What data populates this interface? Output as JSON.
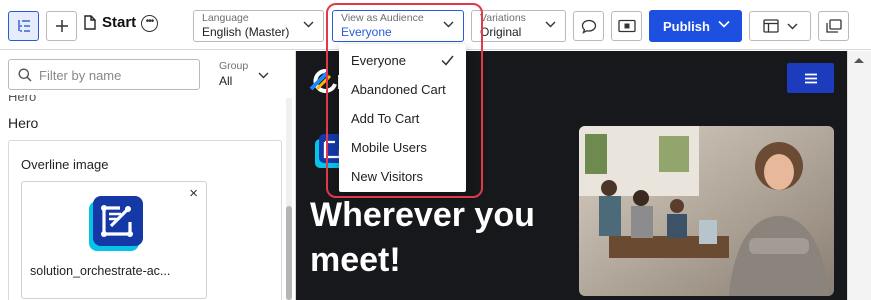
{
  "toolbar": {
    "page_title": "Start",
    "language": {
      "label": "Language",
      "value": "English (Master)"
    },
    "audience": {
      "label": "View as Audience",
      "value": "Everyone"
    },
    "variations": {
      "label": "Variations",
      "value": "Original"
    },
    "publish_label": "Publish"
  },
  "sidebar": {
    "filter_placeholder": "Filter by name",
    "group": {
      "label": "Group",
      "value": "All"
    },
    "crumb": "Hero",
    "section_title": "Hero",
    "card": {
      "title": "Overline image",
      "file_name": "solution_orchestrate-ac...",
      "remove_glyph": "×"
    }
  },
  "audience_menu": {
    "options": [
      "Everyone",
      "Abandoned Cart",
      "Add To Cart",
      "Mobile Users",
      "New Visitors"
    ],
    "selected": "Everyone"
  },
  "preview": {
    "headline": "Wherever you meet!"
  },
  "colors": {
    "accent": "#1d4fe0",
    "highlight": "#e0394a",
    "preview_bg": "#17181b"
  }
}
